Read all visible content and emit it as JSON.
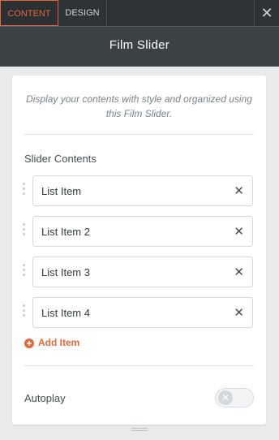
{
  "tabs": {
    "content": "Content",
    "design": "Design"
  },
  "close_icon": "close-icon",
  "title": "Film Slider",
  "description": "Display your contents with style and organized using this Film Slider.",
  "slider_contents": {
    "label": "Slider Contents",
    "items": [
      {
        "label": "List Item"
      },
      {
        "label": "List Item 2"
      },
      {
        "label": "List Item 3"
      },
      {
        "label": "List Item 4"
      }
    ],
    "add_label": "Add Item"
  },
  "autoplay": {
    "label": "Autoplay",
    "enabled": false
  },
  "colors": {
    "accent": "#e06a3b",
    "header_bg": "#2e3436",
    "title_bg": "#3b4245"
  }
}
